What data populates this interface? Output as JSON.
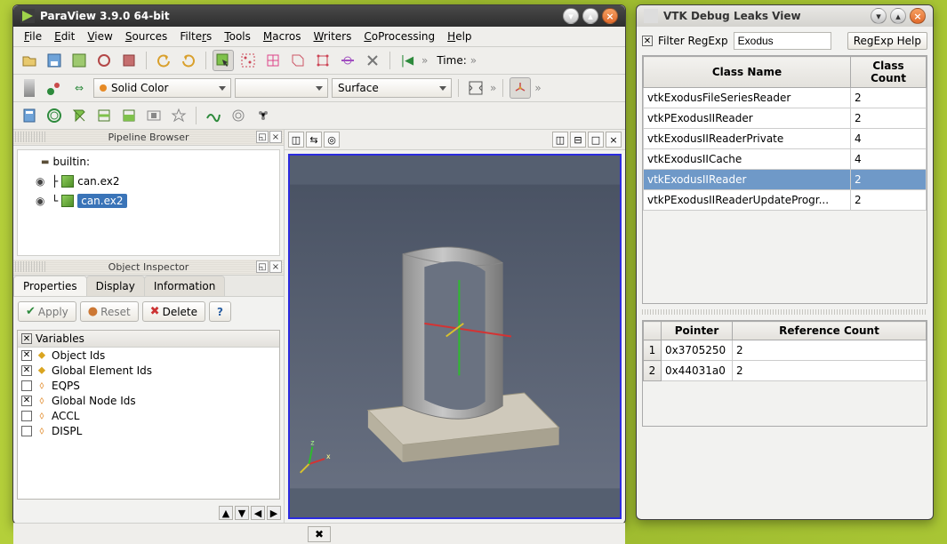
{
  "paraview": {
    "title": "ParaView 3.9.0 64-bit",
    "menu": [
      "File",
      "Edit",
      "View",
      "Sources",
      "Filters",
      "Tools",
      "Macros",
      "Writers",
      "CoProcessing",
      "Help"
    ],
    "time_label": "Time:",
    "color_combo": "Solid Color",
    "repr_combo": "Surface",
    "pipeline_title": "Pipeline Browser",
    "builtin": "builtin:",
    "items": [
      "can.ex2",
      "can.ex2"
    ],
    "inspector_title": "Object Inspector",
    "tabs": {
      "properties": "Properties",
      "display": "Display",
      "information": "Information"
    },
    "buttons": {
      "apply": "Apply",
      "reset": "Reset",
      "delete": "Delete",
      "help": "?"
    },
    "vars_header": "Variables",
    "vars": [
      {
        "checked": true,
        "glyph": "⬥",
        "gclass": "y",
        "name": "Object Ids"
      },
      {
        "checked": true,
        "glyph": "⬥",
        "gclass": "y",
        "name": "Global Element Ids"
      },
      {
        "checked": false,
        "glyph": "⬨",
        "gclass": "o",
        "name": "EQPS"
      },
      {
        "checked": true,
        "glyph": "⬨",
        "gclass": "o",
        "name": "Global Node Ids"
      },
      {
        "checked": false,
        "glyph": "⬨",
        "gclass": "o",
        "name": "ACCL"
      },
      {
        "checked": false,
        "glyph": "⬨",
        "gclass": "o",
        "name": "DISPL"
      }
    ]
  },
  "vtk": {
    "title": "VTK Debug Leaks View",
    "filter_label": "Filter RegExp",
    "filter_value": "Exodus",
    "regexp_help": "RegExp Help",
    "classes": {
      "headers": [
        "Class Name",
        "Class Count"
      ],
      "rows": [
        {
          "name": "vtkExodusFileSeriesReader",
          "count": "2",
          "sel": false
        },
        {
          "name": "vtkPExodusIIReader",
          "count": "2",
          "sel": false
        },
        {
          "name": "vtkExodusIIReaderPrivate",
          "count": "4",
          "sel": false
        },
        {
          "name": "vtkExodusIICache",
          "count": "4",
          "sel": false
        },
        {
          "name": "vtkExodusIIReader",
          "count": "2",
          "sel": true
        },
        {
          "name": "vtkPExodusIIReaderUpdateProgr...",
          "count": "2",
          "sel": false
        }
      ]
    },
    "pointers": {
      "headers": [
        "Pointer",
        "Reference Count"
      ],
      "rows": [
        {
          "idx": "1",
          "ptr": "0x3705250",
          "ref": "2"
        },
        {
          "idx": "2",
          "ptr": "0x44031a0",
          "ref": "2"
        }
      ]
    }
  }
}
